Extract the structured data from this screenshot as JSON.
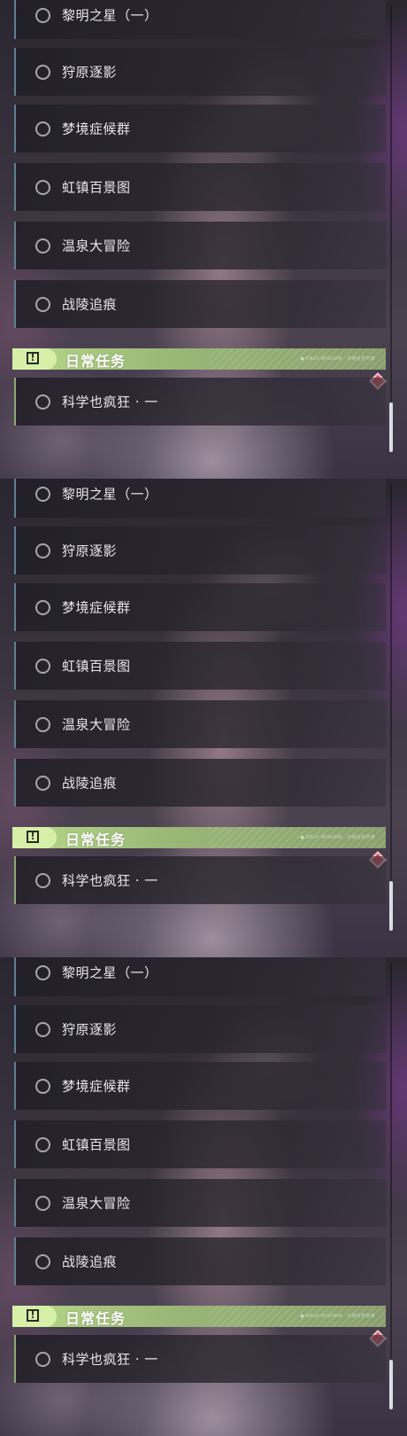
{
  "quests": [
    "黎明之星（一）",
    "狩原逐影",
    "梦境症候群",
    "虹镇百景图",
    "温泉大冒险",
    "战陵追痕"
  ],
  "daily_section": {
    "title": "日常任务",
    "subtext": "● DAILY MISSION · 日常任务列表"
  },
  "daily_quest": "科学也疯狂 · 一",
  "colors": {
    "accent": "#b7d98a",
    "quest_border": "#5e7f90",
    "marker": "#d9535e"
  },
  "icons": {
    "quest_radio": "circle-outline-icon",
    "section_icon": "exclamation-box-icon",
    "tracking_marker": "diamond-marker-icon"
  }
}
